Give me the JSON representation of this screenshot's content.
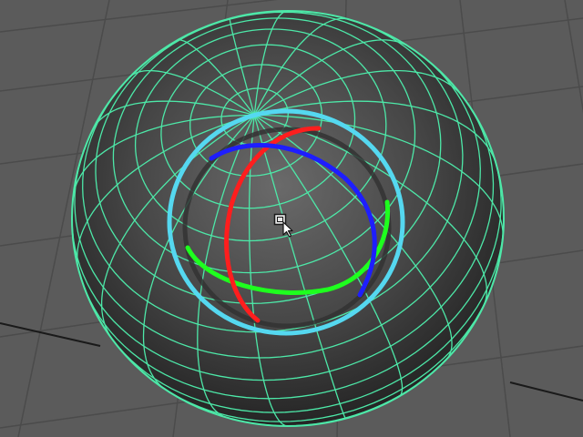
{
  "viewport": {
    "background": "#5b5b5b",
    "grid_color": "#4b4b4b",
    "grid_axis_color": "#1a1a1a"
  },
  "object": {
    "type": "polySphere",
    "wireframe_color": "#4de8a8",
    "selected": true,
    "surface_color": "#484848"
  },
  "manipulator": {
    "tool": "rotate",
    "outer_ring_color": "#55d8f0",
    "x_axis_color": "#ff1e1e",
    "y_axis_color": "#1eff1e",
    "z_axis_color": "#1e1eff",
    "trackball_color": "#3a3a3a"
  },
  "cursor": {
    "icon": "rotate-cursor-icon"
  }
}
